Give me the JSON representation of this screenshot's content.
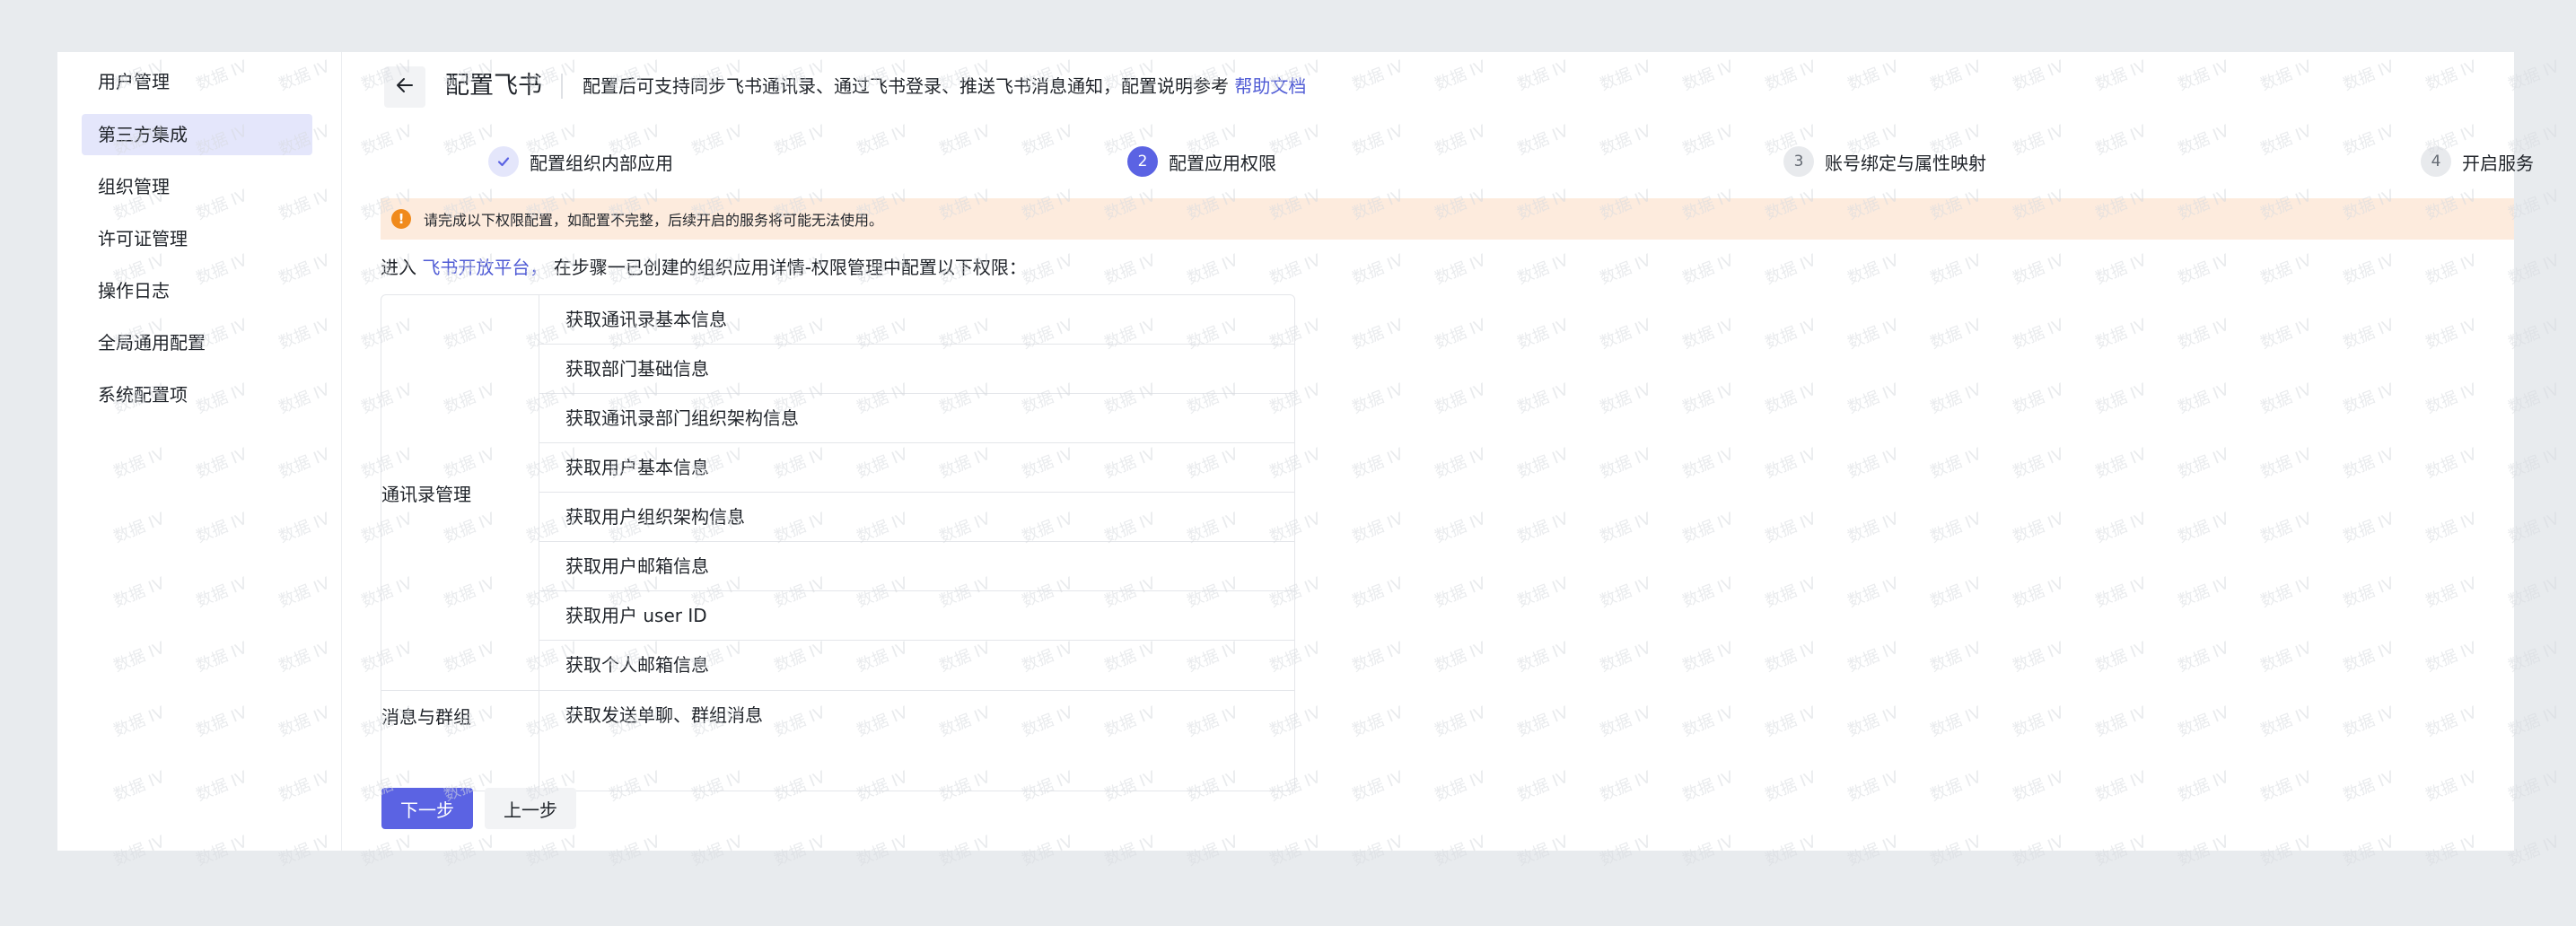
{
  "sidebar": {
    "items": [
      {
        "label": "用户管理",
        "active": false
      },
      {
        "label": "第三方集成",
        "active": true
      },
      {
        "label": "组织管理",
        "active": false
      },
      {
        "label": "许可证管理",
        "active": false
      },
      {
        "label": "操作日志",
        "active": false
      },
      {
        "label": "全局通用配置",
        "active": false
      },
      {
        "label": "系统配置项",
        "active": false
      }
    ]
  },
  "header": {
    "title": "配置飞书",
    "description": "配置后可支持同步飞书通讯录、通过飞书登录、推送飞书消息通知，配置说明参考",
    "help_link": "帮助文档"
  },
  "steps": [
    {
      "label": "配置组织内部应用",
      "status": "done",
      "number": ""
    },
    {
      "label": "配置应用权限",
      "status": "active",
      "number": "2"
    },
    {
      "label": "账号绑定与属性映射",
      "status": "wait",
      "number": "3"
    },
    {
      "label": "开启服务",
      "status": "wait",
      "number": "4"
    }
  ],
  "alert": {
    "text": "请完成以下权限配置，如配置不完整，后续开启的服务将可能无法使用。"
  },
  "intro": {
    "prefix": "进入",
    "link": "飞书开放平台，",
    "suffix": "在步骤一已创建的组织应用详情-权限管理中配置以下权限："
  },
  "permissions": {
    "groups": [
      {
        "name": "通讯录管理",
        "items": [
          "获取通讯录基本信息",
          "获取部门基础信息",
          "获取通讯录部门组织架构信息",
          "获取用户基本信息",
          "获取用户组织架构信息",
          "获取用户邮箱信息",
          "获取用户 user ID",
          "获取个人邮箱信息"
        ]
      },
      {
        "name": "消息与群组",
        "items": [
          "获取发送单聊、群组消息"
        ]
      }
    ]
  },
  "buttons": {
    "next": "下一步",
    "prev": "上一步"
  },
  "watermark": "数据 IV",
  "colors": {
    "accent": "#5b63e3",
    "link": "#4f5bd5",
    "alert_bg": "#fdebdd",
    "alert_icon": "#f08a1c",
    "sidebar_active_bg": "#e4e6fb"
  },
  "icons": {
    "back": "arrow-left-icon",
    "step_done": "check-icon",
    "alert": "warning-circle-icon"
  }
}
